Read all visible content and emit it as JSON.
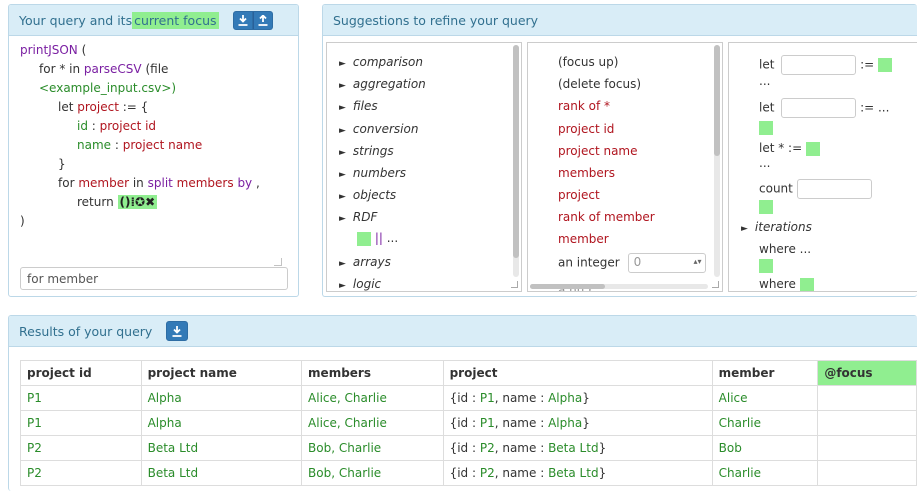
{
  "query": {
    "title_prefix": "Your query and its ",
    "title_highlight": "current focus",
    "download_icon": "download-icon",
    "upload_icon": "upload-icon",
    "lines": {
      "l1_fn": "printJSON",
      "l1_rest": " (",
      "l2_pre": "for * in ",
      "l2_fn": "parseCSV",
      "l2_rest": " (file",
      "l3": "<example_input.csv>)",
      "l4_let": "let ",
      "l4_var": "project",
      "l4_rest": " := {",
      "l5_key": "id",
      "l5_sep": " : ",
      "l5_val": "project id",
      "l6_key": "name",
      "l6_sep": " : ",
      "l6_val": "project name",
      "l7": "}",
      "l8_for": "for ",
      "l8_var": "member",
      "l8_in": " in ",
      "l8_fn": "split",
      "l8_arg": " members ",
      "l8_by": "by",
      "l8_rest": " ,",
      "l9_ret": "return ",
      "l9_focus": "()",
      "l9_icons": "⁞✪✖",
      "l10": ")"
    },
    "focus_input_value": "for member"
  },
  "suggestions": {
    "title": "Suggestions to refine your query",
    "categories": [
      "comparison",
      "aggregation",
      "files",
      "conversion",
      "strings",
      "numbers",
      "objects",
      "RDF",
      "arrays",
      "logic"
    ],
    "or_item": "||",
    "or_dots": " ...",
    "col2": {
      "focus_up": "(focus up)",
      "delete_focus": "(delete focus)",
      "rank_of_all": "rank of *",
      "project_id": "project id",
      "project_name": "project name",
      "members": "members",
      "project": "project",
      "rank_of_member": "rank of member",
      "member": "member",
      "an_integer": "an integer",
      "integer_placeholder": "0",
      "partial": "a nu   r"
    },
    "col3": {
      "let1": "let",
      "assign1": ":=",
      "ellipsis": "...",
      "let2": "let",
      "assign2": ":= ...",
      "let3": "let * :=",
      "count": "count",
      "iterations": "iterations",
      "where": "where ...",
      "where2": "where"
    }
  },
  "results": {
    "title": "Results of your query",
    "headers": [
      "project id",
      "project name",
      "members",
      "project",
      "member",
      "@focus"
    ],
    "rows": [
      {
        "id": "P1",
        "name": "Alpha",
        "members": "Alice, Charlie",
        "proj_id": "P1",
        "proj_name": "Alpha",
        "member": "Alice"
      },
      {
        "id": "P1",
        "name": "Alpha",
        "members": "Alice, Charlie",
        "proj_id": "P1",
        "proj_name": "Alpha",
        "member": "Charlie"
      },
      {
        "id": "P2",
        "name": "Beta Ltd",
        "members": "Bob, Charlie",
        "proj_id": "P2",
        "proj_name": "Beta Ltd",
        "member": "Bob"
      },
      {
        "id": "P2",
        "name": "Beta Ltd",
        "members": "Bob, Charlie",
        "proj_id": "P2",
        "proj_name": "Beta Ltd",
        "member": "Charlie"
      }
    ],
    "obj_open": "{id : ",
    "obj_mid": ", name : ",
    "obj_close": "}"
  },
  "colors": {
    "accent": "#337ab7",
    "panel_header_bg": "#d9edf7",
    "focus_green": "#90ee90",
    "value_green": "#2a8c2a",
    "keyword_red": "#b0151f",
    "keyword_purple": "#7a1fa2"
  }
}
